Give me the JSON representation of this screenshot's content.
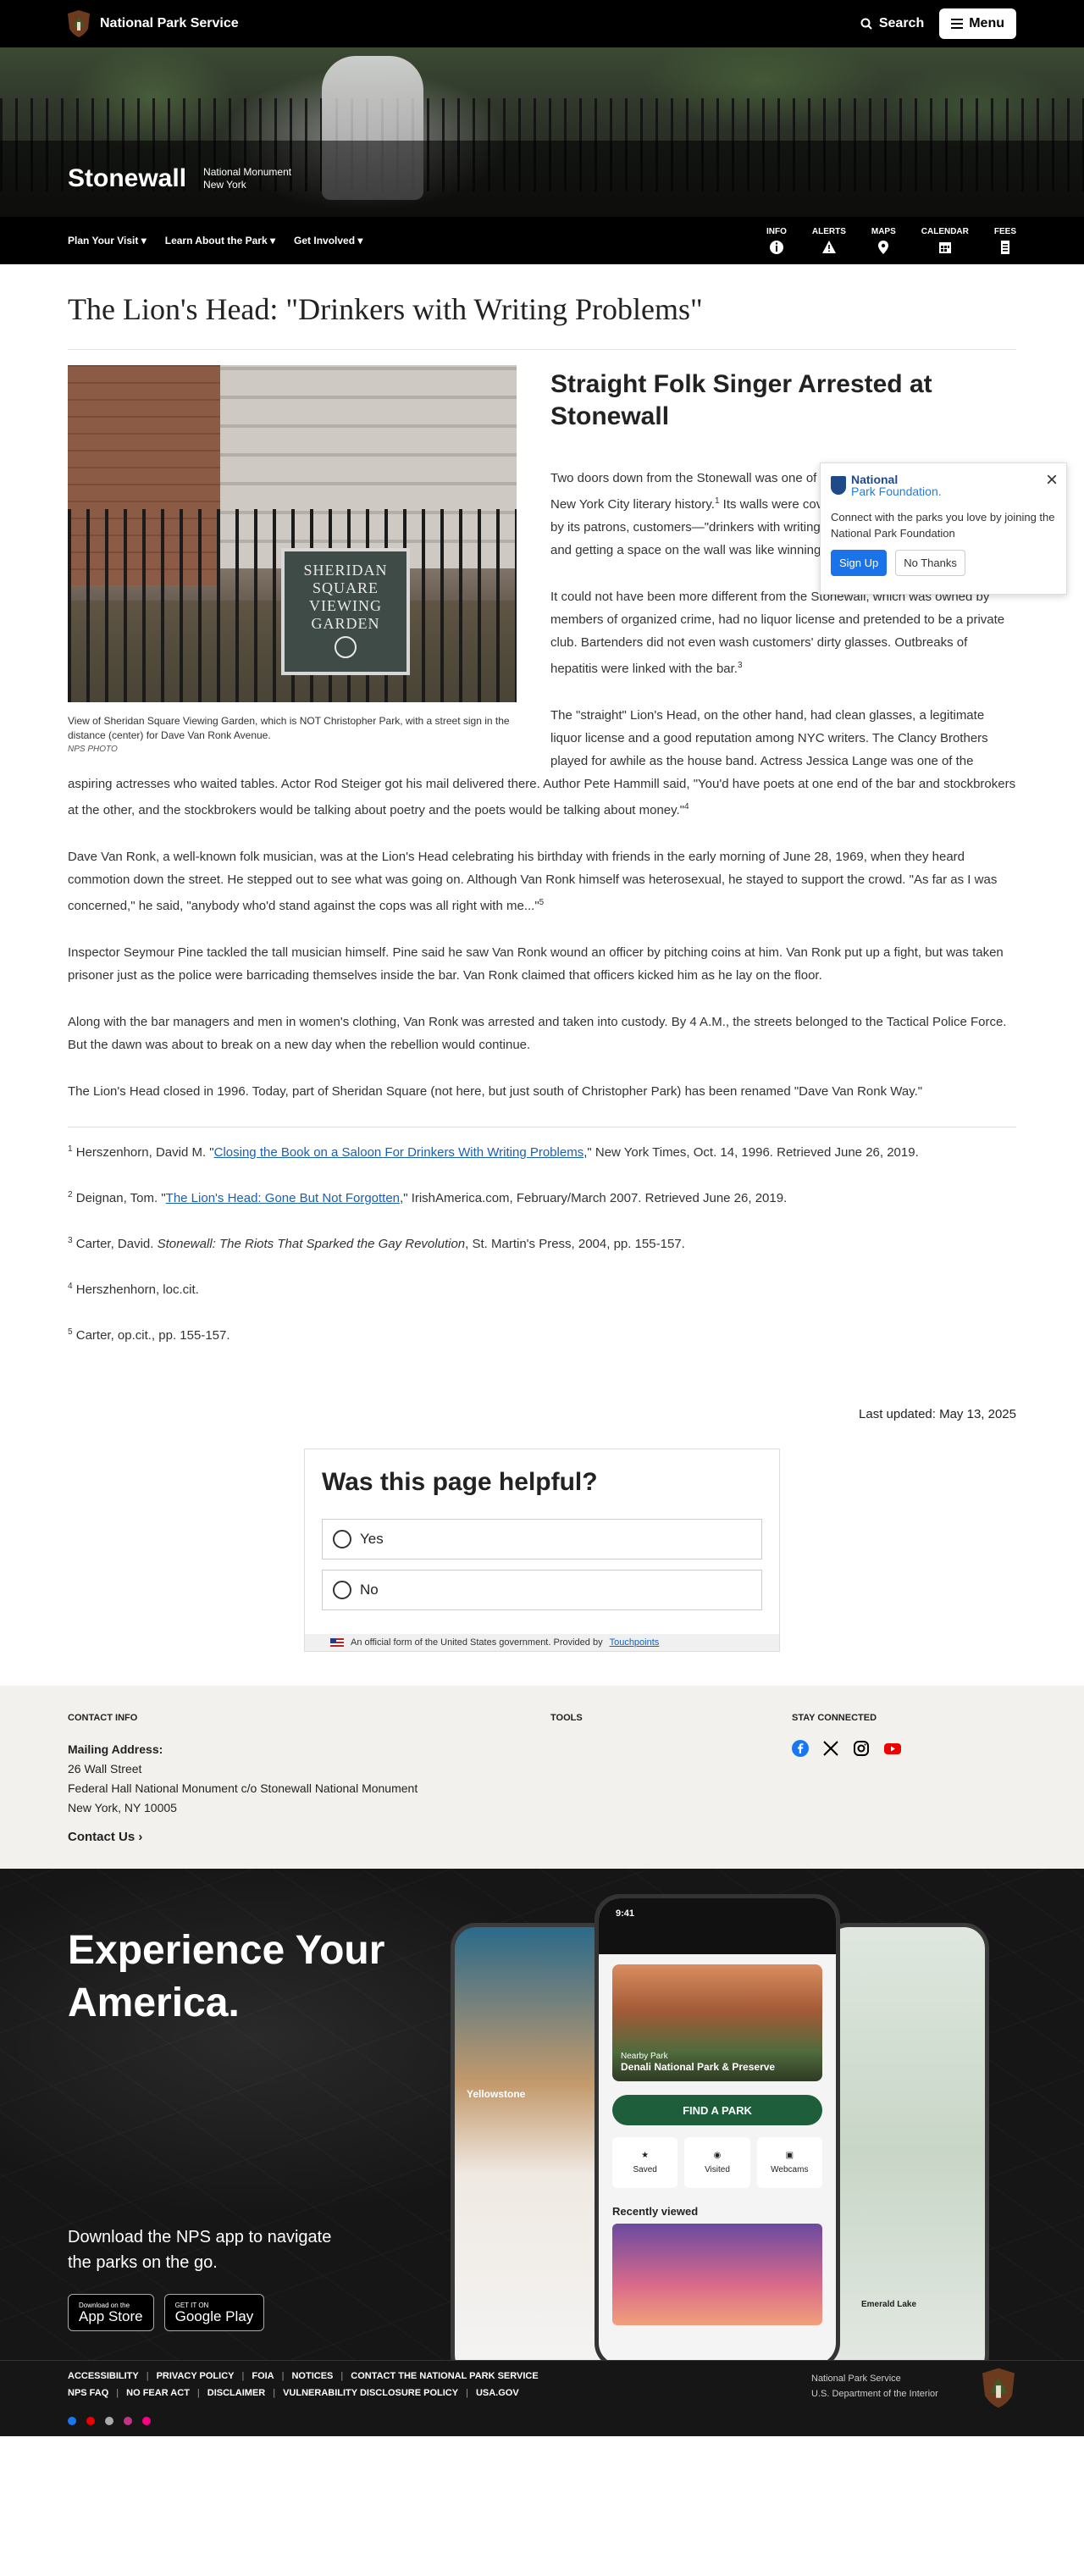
{
  "header": {
    "brand": "National Park Service",
    "search_label": "Search",
    "menu_label": "Menu"
  },
  "hero": {
    "park_name": "Stonewall",
    "designation": "National Monument",
    "state": "New York"
  },
  "park_nav": {
    "dropdowns": [
      "Plan Your Visit",
      "Learn About the Park",
      "Get Involved"
    ],
    "quick_links": [
      {
        "label": "INFO",
        "icon": "info-icon"
      },
      {
        "label": "ALERTS",
        "icon": "alert-icon"
      },
      {
        "label": "MAPS",
        "icon": "map-pin-icon"
      },
      {
        "label": "CALENDAR",
        "icon": "calendar-icon"
      },
      {
        "label": "FEES",
        "icon": "receipt-icon"
      }
    ]
  },
  "article": {
    "title": "The Lion's Head: \"Drinkers with Writing Problems\"",
    "image": {
      "sign_lines": [
        "SHERIDAN",
        "SQUARE",
        "VIEWING",
        "GARDEN"
      ],
      "caption": "View of Sheridan Square Viewing Garden, which is NOT Christopher Park, with a street sign in the distance (center) for Dave Van Ronk Avenue.",
      "credit": "NPS PHOTO"
    },
    "heading": "Straight Folk Singer Arrested at Stonewall",
    "p1": {
      "a": "Two doors down from the Stonewall was one of the most famous restaurants in New York City literary history.",
      "sup": "1",
      "b": " Its walls were covered with jacket covers of books by its patrons, customers—\"drinkers with writing problems,\" as its custom said, and getting a space on the wall was like winning the Pulitzer."
    },
    "p2": {
      "a": "It could not have been more different from the Stonewall, which was owned by members of organized crime, had no liquor license and pretended to be a private club. Bartenders did not even wash customers' dirty glasses. Outbreaks of hepatitis were linked with the bar.",
      "sup": "3"
    },
    "p3": {
      "a": "The \"straight\" Lion's Head, on the other hand, had clean glasses, a legitimate liquor license and a good reputation among NYC writers. The Clancy Brothers played for awhile as the house band. Actress Jessica Lange was one of the aspiring actresses who waited tables. Actor Rod Steiger got his mail delivered there. Author Pete Hammill said, \"You'd have poets at one end of the bar and stockbrokers at the other, and the stockbrokers would be talking about poetry and the poets would be talking about money.\"",
      "sup": "4"
    },
    "p4": {
      "a": "Dave Van Ronk, a well-known folk musician, was at the Lion's Head celebrating his birthday with friends in the early morning of June 28, 1969, when they heard commotion down the street. He stepped out to see what was going on. Although Van Ronk himself was heterosexual, he stayed to support the crowd. \"As far as I was concerned,\" he said, \"anybody who'd stand against the cops was all right with me...\"",
      "sup": "5"
    },
    "p5": "Inspector Seymour Pine tackled the tall musician himself. Pine said he saw Van Ronk wound an officer by pitching coins at him. Van Ronk put up a fight, but was taken prisoner just as the police were barricading themselves inside the bar. Van Ronk claimed that officers kicked him as he lay on the floor.",
    "p6": "Along with the bar managers and men in women's clothing, Van Ronk was arrested and taken into custody. By 4 A.M., the streets belonged to the Tactical Police Force. But the dawn was about to break on a new day when the rebellion would continue.",
    "p7": "The Lion's Head closed in 1996. Today, part of Sheridan Square (not here, but just south of Christopher Park) has been renamed \"Dave Van Ronk Way.\"",
    "footnotes": [
      {
        "num": "1",
        "pre": "Herszenhorn, David M. \"",
        "link": "Closing the Book on a Saloon For Drinkers With Writing Problems",
        "post": ",\" New York Times, Oct. 14, 1996. Retrieved June 26, 2019."
      },
      {
        "num": "2",
        "pre": "Deignan, Tom. \"",
        "link": "The Lion's Head: Gone But Not Forgotten",
        "post": ",\" IrishAmerica.com, February/March 2007. Retrieved June 26, 2019."
      },
      {
        "num": "3",
        "pre": "Carter, David. ",
        "italic": "Stonewall: The Riots That Sparked the Gay Revolution",
        "post": ", St. Martin's Press, 2004, pp. 155-157."
      },
      {
        "num": "4",
        "pre": "Herszhenhorn, loc.cit."
      },
      {
        "num": "5",
        "pre": "Carter, op.cit., pp. 155-157."
      }
    ],
    "last_updated": "Last updated: May 13, 2025"
  },
  "popup": {
    "brand_top": "National",
    "brand_bottom": "Park Foundation.",
    "message": "Connect with the parks you love by joining the National Park Foundation",
    "primary": "Sign Up",
    "secondary": "No Thanks"
  },
  "feedback": {
    "question": "Was this page helpful?",
    "yes": "Yes",
    "no": "No",
    "gov_text": "An official form of the United States government. Provided by",
    "gov_link": "Touchpoints"
  },
  "info_footer": {
    "contact_heading": "CONTACT INFO",
    "tools_heading": "TOOLS",
    "stay_heading": "STAY CONNECTED",
    "mailing_label": "Mailing Address:",
    "address_lines": [
      "26 Wall Street",
      "Federal Hall National Monument c/o Stonewall National Monument",
      "New York, NY 10005"
    ],
    "contact_link": "Contact Us"
  },
  "app_promo": {
    "title": "Experience Your America.",
    "text": "Download the NPS app to navigate the parks on the go.",
    "app_store_small": "Download on the",
    "app_store": "App Store",
    "google_small": "GET IT ON",
    "google": "Google Play",
    "phone": {
      "time": "9:41",
      "nearby": "Nearby Park",
      "park": "Denali National Park & Preserve",
      "find": "FIND A PARK",
      "tiles": [
        "Saved",
        "Visited",
        "Webcams"
      ],
      "recent": "Recently viewed"
    },
    "left_phone_label": "Yellowstone",
    "right_phone_label": "Emerald Lake"
  },
  "bottom_footer": {
    "row1": [
      "ACCESSIBILITY",
      "PRIVACY POLICY",
      "FOIA",
      "NOTICES",
      "CONTACT THE NATIONAL PARK SERVICE"
    ],
    "row2": [
      "NPS FAQ",
      "NO FEAR ACT",
      "DISCLAIMER",
      "VULNERABILITY DISCLOSURE POLICY",
      "USA.GOV"
    ],
    "dept_line1": "National Park Service",
    "dept_line2": "U.S. Department of the Interior"
  },
  "colors": {
    "black": "#000000",
    "link": "#1a5fb4",
    "signup": "#1a73e8",
    "find_park": "#1e5e3a",
    "footer_bg": "#161616"
  }
}
